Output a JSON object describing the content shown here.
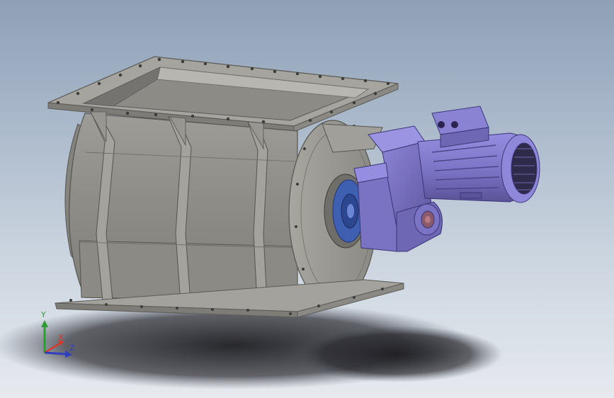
{
  "viewport": {
    "background_top": "#8fa0b6",
    "background_bottom": "#e6eaef"
  },
  "model": {
    "valve_body_color": "#8f8e88",
    "motor_color": "#7b73c4",
    "bearing_color": "#3f5fb0",
    "shadow_color": "#1e1e22"
  },
  "triad": {
    "y_label": "Y",
    "x_label": "X",
    "z_label": "Z",
    "y_color": "#2f9a35",
    "x_color": "#d23a2c",
    "z_color": "#2f3fbf"
  }
}
